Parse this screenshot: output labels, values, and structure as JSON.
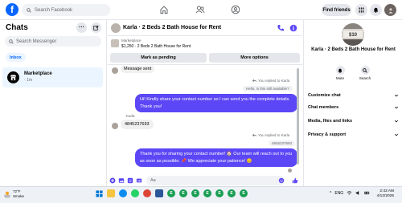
{
  "topnav": {
    "logo": "f",
    "search_placeholder": "Search Facebook",
    "find_friends_label": "Find friends"
  },
  "sidebar": {
    "title": "Chats",
    "search_placeholder": "Search Messenger",
    "inbox_label": "Inbox",
    "items": [
      {
        "name": "Marketplace",
        "time": "· 1m"
      }
    ]
  },
  "conversation": {
    "title": "Karla · 2 Beds 2 Bath House for Rent",
    "marketplace_label": "Marketplace",
    "listing": "$1,250 · 2 Beds 2 Bath House for Rent",
    "mark_pending_label": "Mark as pending",
    "more_options_label": "More options",
    "messages": {
      "m1_partial": "Message sent",
      "reply_note_1": "You replied to Karla",
      "quoted_1": "Hello, is this still available?",
      "out_1": "Hi! Kindly share your contact number so I can send you the complete details. Thank you!",
      "sender_label": "Karla",
      "in_1": "4845237693",
      "reply_note_2": "You replied to Karla",
      "quoted_2": "4845237693",
      "out_2": "Thank you for sharing your contact number! 🏠 Our team will reach out to you as soon as possible. 📌 We appreciate your patience! 😊"
    },
    "input_placeholder": "Aa"
  },
  "info": {
    "avatar_text": "$10",
    "name": "Karla · 2 Beds 2 Bath House for Rent",
    "mute_label": "Mute",
    "search_label": "Search",
    "rows": [
      "Customize chat",
      "Chat members",
      "Media, files and links",
      "Privacy & support"
    ]
  },
  "taskbar": {
    "temp": "72°F",
    "weather_desc": "Smoke",
    "time": "2:43 AM",
    "date": "4/12/2025",
    "lang": "ENG",
    "app_badges": [
      "E",
      "E",
      "E",
      "E",
      "E",
      "E",
      "E"
    ]
  },
  "colors": {
    "accent": "#0866ff",
    "outgoing_bubble": "#5b47f5",
    "incoming_bubble": "#f0f0f0"
  }
}
